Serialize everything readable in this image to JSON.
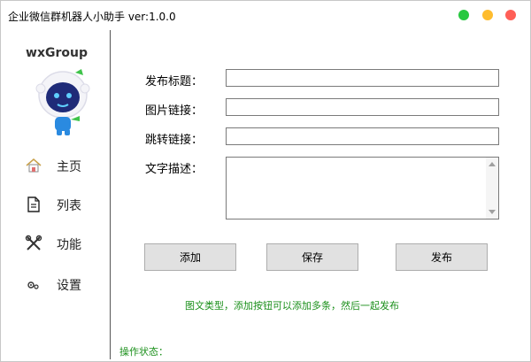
{
  "window": {
    "title": "企业微信群机器人小助手 ver:1.0.0"
  },
  "sidebar": {
    "brand": "wxGroup",
    "items": [
      {
        "label": "主页",
        "icon": "home-icon"
      },
      {
        "label": "列表",
        "icon": "document-icon"
      },
      {
        "label": "功能",
        "icon": "tools-icon"
      },
      {
        "label": "设置",
        "icon": "gears-icon"
      }
    ]
  },
  "form": {
    "title_label": "发布标题：",
    "title_value": "",
    "image_label": "图片链接：",
    "image_value": "",
    "jump_label": "跳转链接：",
    "jump_value": "",
    "desc_label": "文字描述：",
    "desc_value": ""
  },
  "buttons": {
    "add": "添加",
    "save": "保存",
    "publish": "发布"
  },
  "hint": "图文类型，添加按钮可以添加多条，然后一起发布",
  "status_label": "操作状态："
}
